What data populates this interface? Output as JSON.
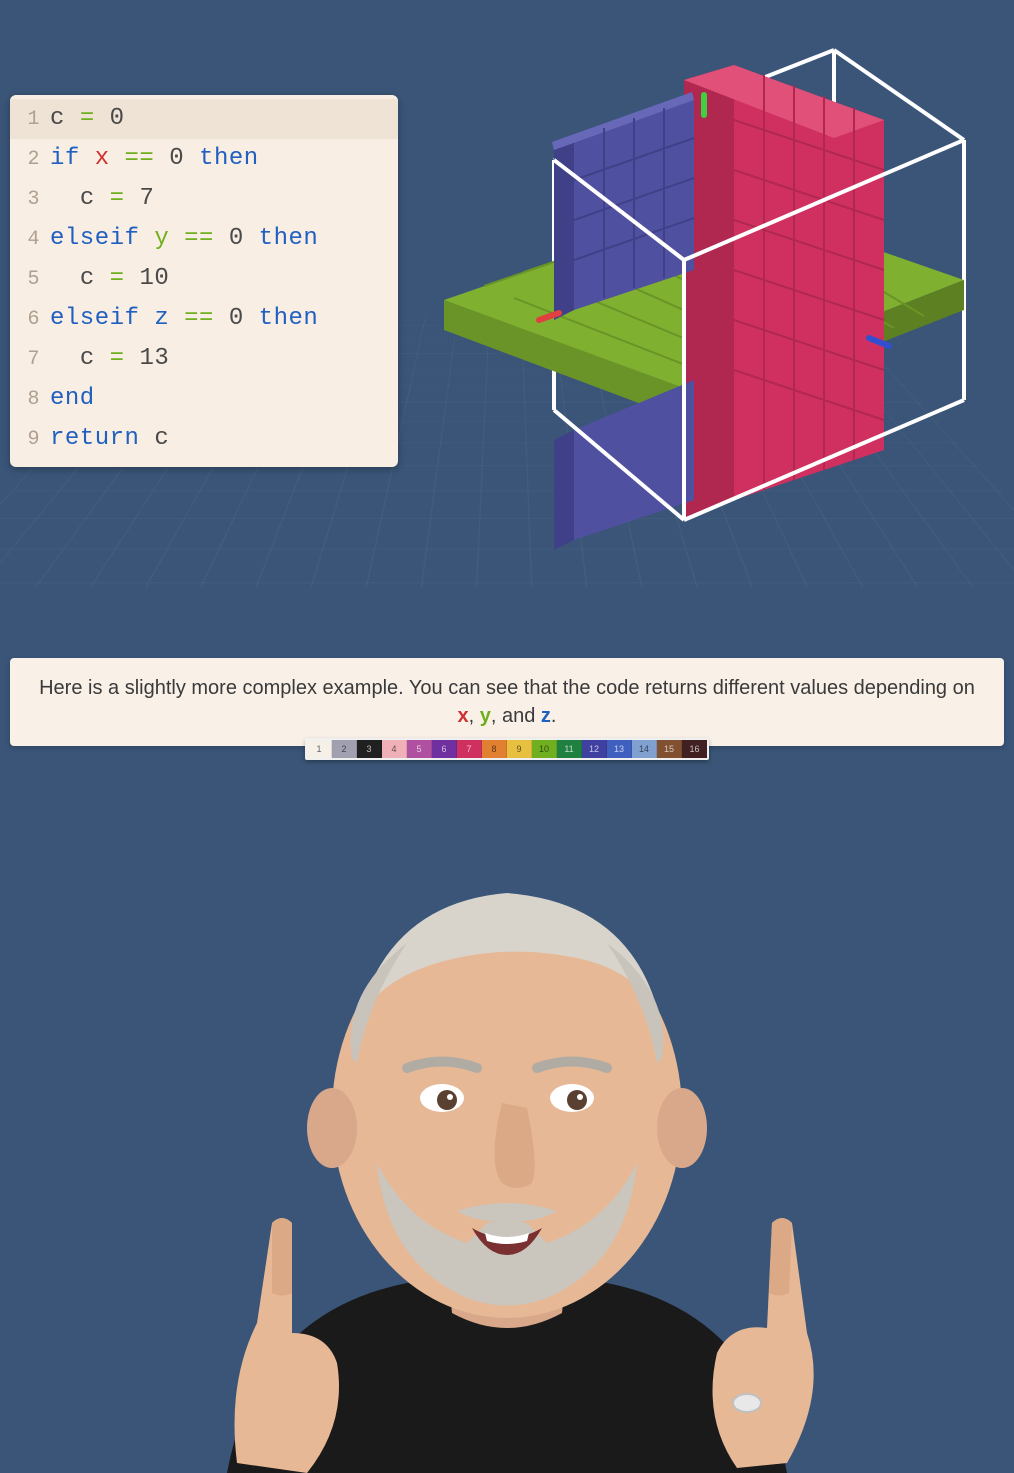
{
  "code": {
    "lines": [
      {
        "n": "1",
        "highlight": true,
        "indent": "",
        "tokens": [
          [
            "var-c",
            "c"
          ],
          [
            "tok",
            " "
          ],
          [
            "op",
            "="
          ],
          [
            "tok",
            " "
          ],
          [
            "num",
            "0"
          ]
        ]
      },
      {
        "n": "2",
        "highlight": false,
        "indent": "",
        "tokens": [
          [
            "kw",
            "if"
          ],
          [
            "tok",
            " "
          ],
          [
            "var-x",
            "x"
          ],
          [
            "tok",
            " "
          ],
          [
            "op",
            "=="
          ],
          [
            "tok",
            " "
          ],
          [
            "num",
            "0"
          ],
          [
            "tok",
            " "
          ],
          [
            "kw",
            "then"
          ]
        ]
      },
      {
        "n": "3",
        "highlight": false,
        "indent": "  ",
        "tokens": [
          [
            "var-c",
            "c"
          ],
          [
            "tok",
            " "
          ],
          [
            "op",
            "="
          ],
          [
            "tok",
            " "
          ],
          [
            "num",
            "7"
          ]
        ]
      },
      {
        "n": "4",
        "highlight": false,
        "indent": "",
        "tokens": [
          [
            "kw",
            "elseif"
          ],
          [
            "tok",
            " "
          ],
          [
            "var-y",
            "y"
          ],
          [
            "tok",
            " "
          ],
          [
            "op",
            "=="
          ],
          [
            "tok",
            " "
          ],
          [
            "num",
            "0"
          ],
          [
            "tok",
            " "
          ],
          [
            "kw",
            "then"
          ]
        ]
      },
      {
        "n": "5",
        "highlight": false,
        "indent": "  ",
        "tokens": [
          [
            "var-c",
            "c"
          ],
          [
            "tok",
            " "
          ],
          [
            "op",
            "="
          ],
          [
            "tok",
            " "
          ],
          [
            "num",
            "10"
          ]
        ]
      },
      {
        "n": "6",
        "highlight": false,
        "indent": "",
        "tokens": [
          [
            "kw",
            "elseif"
          ],
          [
            "tok",
            " "
          ],
          [
            "var-z",
            "z"
          ],
          [
            "tok",
            " "
          ],
          [
            "op",
            "=="
          ],
          [
            "tok",
            " "
          ],
          [
            "num",
            "0"
          ],
          [
            "tok",
            " "
          ],
          [
            "kw",
            "then"
          ]
        ]
      },
      {
        "n": "7",
        "highlight": false,
        "indent": "  ",
        "tokens": [
          [
            "var-c",
            "c"
          ],
          [
            "tok",
            " "
          ],
          [
            "op",
            "="
          ],
          [
            "tok",
            " "
          ],
          [
            "num",
            "13"
          ]
        ]
      },
      {
        "n": "8",
        "highlight": false,
        "indent": "",
        "tokens": [
          [
            "kw",
            "end"
          ]
        ]
      },
      {
        "n": "9",
        "highlight": false,
        "indent": "",
        "tokens": [
          [
            "kw",
            "return"
          ],
          [
            "tok",
            " "
          ],
          [
            "var-c",
            "c"
          ]
        ]
      }
    ]
  },
  "caption": {
    "parts": [
      [
        "txt",
        "Here is a slightly more complex example.  You can see that the code returns different values depending on "
      ],
      [
        "var-x",
        "x"
      ],
      [
        "txt",
        ", "
      ],
      [
        "var-y",
        "y"
      ],
      [
        "txt",
        ", and "
      ],
      [
        "var-z",
        "z"
      ],
      [
        "txt",
        "."
      ]
    ]
  },
  "palette": [
    {
      "n": "1",
      "c": "#f5f0e8",
      "dark": false
    },
    {
      "n": "2",
      "c": "#a0a0b0",
      "dark": false
    },
    {
      "n": "3",
      "c": "#202020",
      "dark": true
    },
    {
      "n": "4",
      "c": "#f0b0b8",
      "dark": false
    },
    {
      "n": "5",
      "c": "#b050a0",
      "dark": true
    },
    {
      "n": "6",
      "c": "#7030a0",
      "dark": true
    },
    {
      "n": "7",
      "c": "#d03060",
      "dark": true
    },
    {
      "n": "8",
      "c": "#e08030",
      "dark": false
    },
    {
      "n": "9",
      "c": "#e8c040",
      "dark": false
    },
    {
      "n": "10",
      "c": "#70b020",
      "dark": false
    },
    {
      "n": "11",
      "c": "#208040",
      "dark": true
    },
    {
      "n": "12",
      "c": "#4040a0",
      "dark": true
    },
    {
      "n": "13",
      "c": "#4060c0",
      "dark": true
    },
    {
      "n": "14",
      "c": "#80a0d0",
      "dark": false
    },
    {
      "n": "15",
      "c": "#805030",
      "dark": true
    },
    {
      "n": "16",
      "c": "#402020",
      "dark": true
    }
  ],
  "scene": {
    "colors": {
      "wall_x": "#d03060",
      "plane_y": "#80b030",
      "slab_z": "#5050a0",
      "wire": "#ffffff"
    }
  }
}
